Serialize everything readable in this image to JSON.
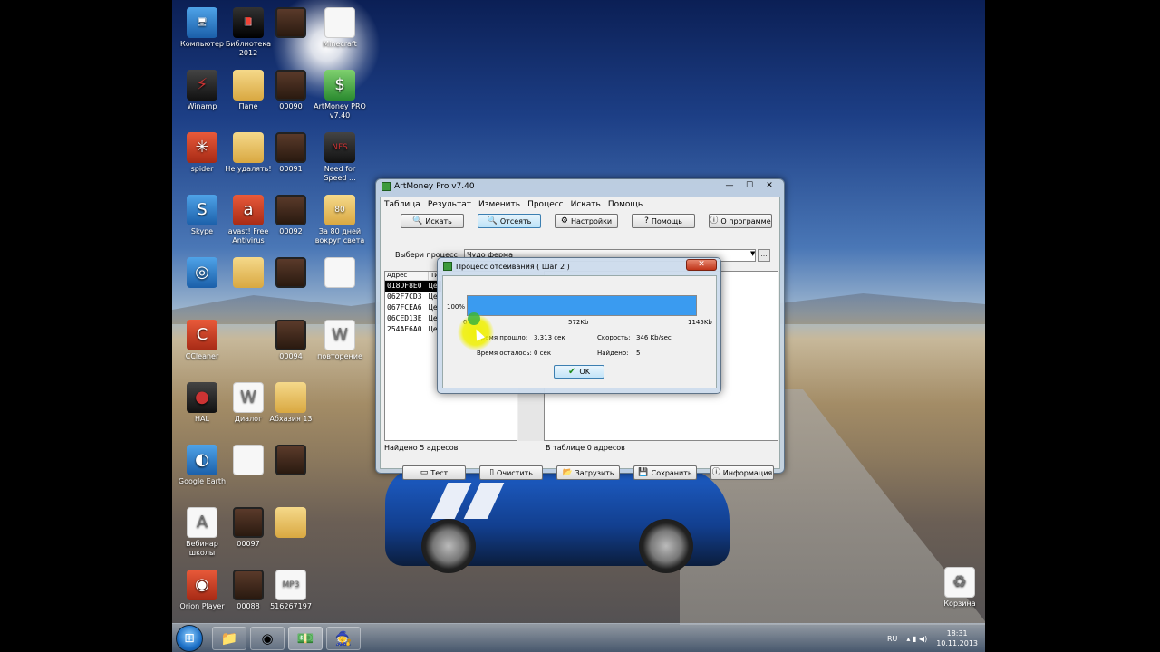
{
  "desktop_icons": [
    {
      "label": "Компьютер",
      "icon": "computer-icon"
    },
    {
      "label": "Библиотека 2012",
      "icon": "book-icon"
    },
    {
      "label": "",
      "icon": "video-icon"
    },
    {
      "label": "Minecraft",
      "icon": "file-icon"
    },
    {
      "label": "Winamp",
      "icon": "winamp-icon"
    },
    {
      "label": "Папе",
      "icon": "folder-icon"
    },
    {
      "label": "00090",
      "icon": "video-icon"
    },
    {
      "label": "ArtMoney PRO v7.40",
      "icon": "artmoney-icon"
    },
    {
      "label": "spider",
      "icon": "spider-icon"
    },
    {
      "label": "Не удалять!",
      "icon": "folder-icon"
    },
    {
      "label": "00091",
      "icon": "video-icon"
    },
    {
      "label": "Need for Speed ...",
      "icon": "nfs-icon"
    },
    {
      "label": "Skype",
      "icon": "skype-icon"
    },
    {
      "label": "avast! Free Antivirus",
      "icon": "avast-icon"
    },
    {
      "label": "00092",
      "icon": "video-icon"
    },
    {
      "label": "За 80 дней вокруг света",
      "icon": "game-icon"
    },
    {
      "label": "",
      "icon": "app-icon"
    },
    {
      "label": "",
      "icon": "folder-icon"
    },
    {
      "label": "",
      "icon": "video-icon"
    },
    {
      "label": "",
      "icon": "file-icon"
    },
    {
      "label": "CCleaner",
      "icon": "ccleaner-icon"
    },
    {
      "label": "00094",
      "icon": "video-icon"
    },
    {
      "label": "повторение",
      "icon": "document-icon"
    },
    {
      "label": "HAL",
      "icon": "hal-icon"
    },
    {
      "label": "Диалог",
      "icon": "document-icon"
    },
    {
      "label": "Абхазия 13",
      "icon": "folder-icon"
    },
    {
      "label": "Google Earth",
      "icon": "globe-icon"
    },
    {
      "label": "",
      "icon": "file-icon"
    },
    {
      "label": "",
      "icon": "video-icon"
    },
    {
      "label": "Вебинар школы",
      "icon": "pdf-icon"
    },
    {
      "label": "00097",
      "icon": "video-icon"
    },
    {
      "label": "",
      "icon": "folder-icon"
    },
    {
      "label": "Orion Player",
      "icon": "player-icon"
    },
    {
      "label": "00088",
      "icon": "video-icon"
    },
    {
      "label": "516267197",
      "icon": "mp3-icon"
    },
    {
      "label": "Корзина",
      "icon": "recycle-bin-icon"
    }
  ],
  "taskbar": {
    "buttons": [
      "explorer-icon",
      "chrome-icon",
      "artmoney-icon",
      "game-icon"
    ],
    "lang": "RU",
    "time": "18:31",
    "date": "10.11.2013"
  },
  "window": {
    "title": "ArtMoney Pro v7.40",
    "menu": [
      "Таблица",
      "Результат",
      "Изменить",
      "Процесс",
      "Искать",
      "Помощь"
    ],
    "toolbar": [
      {
        "label": "Искать",
        "icon": "search-icon"
      },
      {
        "label": "Отсеять",
        "icon": "filter-icon"
      },
      {
        "label": "Настройки",
        "icon": "settings-icon"
      },
      {
        "label": "Помощь",
        "icon": "help-icon"
      },
      {
        "label": "О программе",
        "icon": "info-icon"
      }
    ],
    "process_label": "Выбери процесс",
    "process_value": "Чудо ферма",
    "left_columns": [
      "Адрес",
      "Тип"
    ],
    "addresses": [
      {
        "addr": "018DF8E0",
        "type": "Це"
      },
      {
        "addr": "062F7CD3",
        "type": "Це"
      },
      {
        "addr": "067FCEA6",
        "type": "Це"
      },
      {
        "addr": "06CED13E",
        "type": "Це"
      },
      {
        "addr": "254AF6A0",
        "type": "Це"
      }
    ],
    "left_status": "Найдено 5 адресов",
    "right_status": "В таблице 0 адресов",
    "bottom_buttons": [
      {
        "label": "Тест",
        "icon": "test-icon"
      },
      {
        "label": "Очистить",
        "icon": "clear-icon"
      },
      {
        "label": "Загрузить",
        "icon": "load-icon"
      },
      {
        "label": "Сохранить",
        "icon": "save-icon"
      },
      {
        "label": "Информация",
        "icon": "info-icon"
      }
    ]
  },
  "dialog": {
    "title": "Процесс отсеивания ( Шаг 2 )",
    "percent_label": "100%",
    "progress": 1.0,
    "axis_start": "0",
    "axis_mid": "572Kb",
    "axis_end": "1145Kb",
    "elapsed_label": "Время прошло:",
    "elapsed_value": "3.313 сек",
    "remaining_label": "Время осталось:",
    "remaining_value": "0 сек",
    "speed_label": "Скорость:",
    "speed_value": "346 Kb/sec",
    "found_label": "Найдено:",
    "found_value": "5",
    "ok_label": "OK"
  }
}
